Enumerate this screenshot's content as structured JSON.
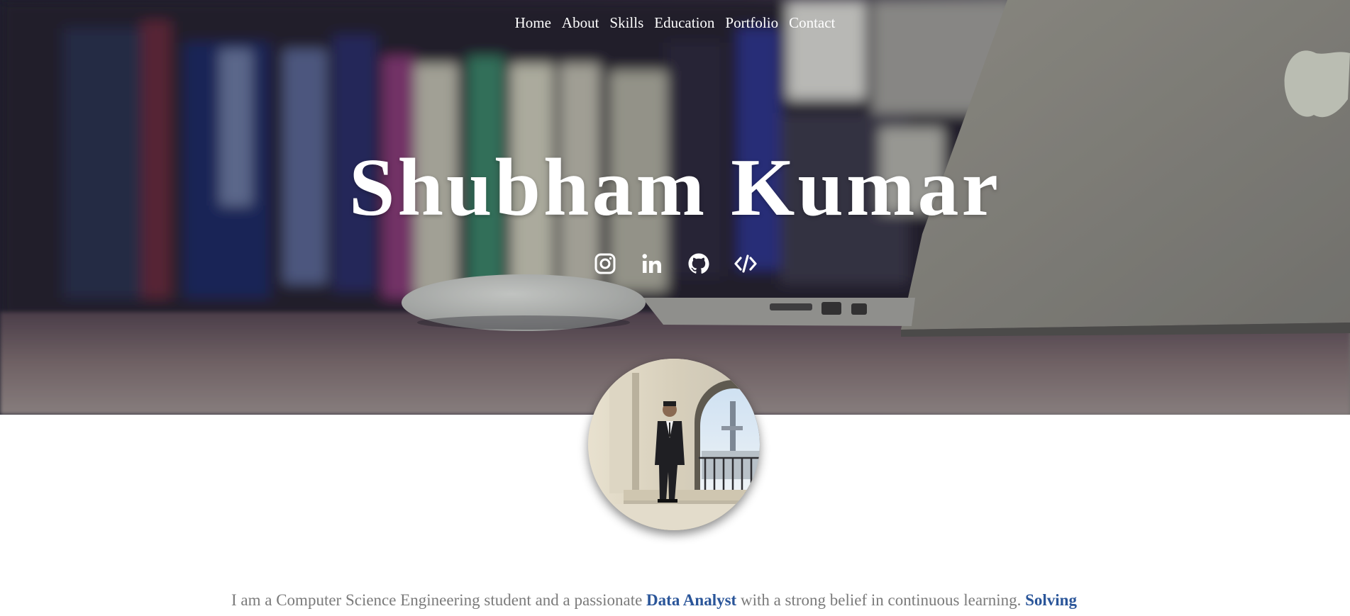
{
  "nav": {
    "items": [
      "Home",
      "About",
      "Skills",
      "Education",
      "Portfolio",
      "Contact"
    ]
  },
  "hero": {
    "name": "Shubham Kumar"
  },
  "socials": [
    {
      "icon": "instagram-icon"
    },
    {
      "icon": "linkedin-icon"
    },
    {
      "icon": "github-icon"
    },
    {
      "icon": "code-icon"
    }
  ],
  "about": {
    "text_1": "I am a Computer Science Engineering student and a passionate ",
    "highlight_1": "Data Analyst",
    "text_2": " with a strong belief in continuous learning. ",
    "highlight_2": "Solving"
  },
  "colors": {
    "accent": "#2a5599",
    "body_text": "#7a7a7a",
    "nav_text": "#ffffff"
  }
}
